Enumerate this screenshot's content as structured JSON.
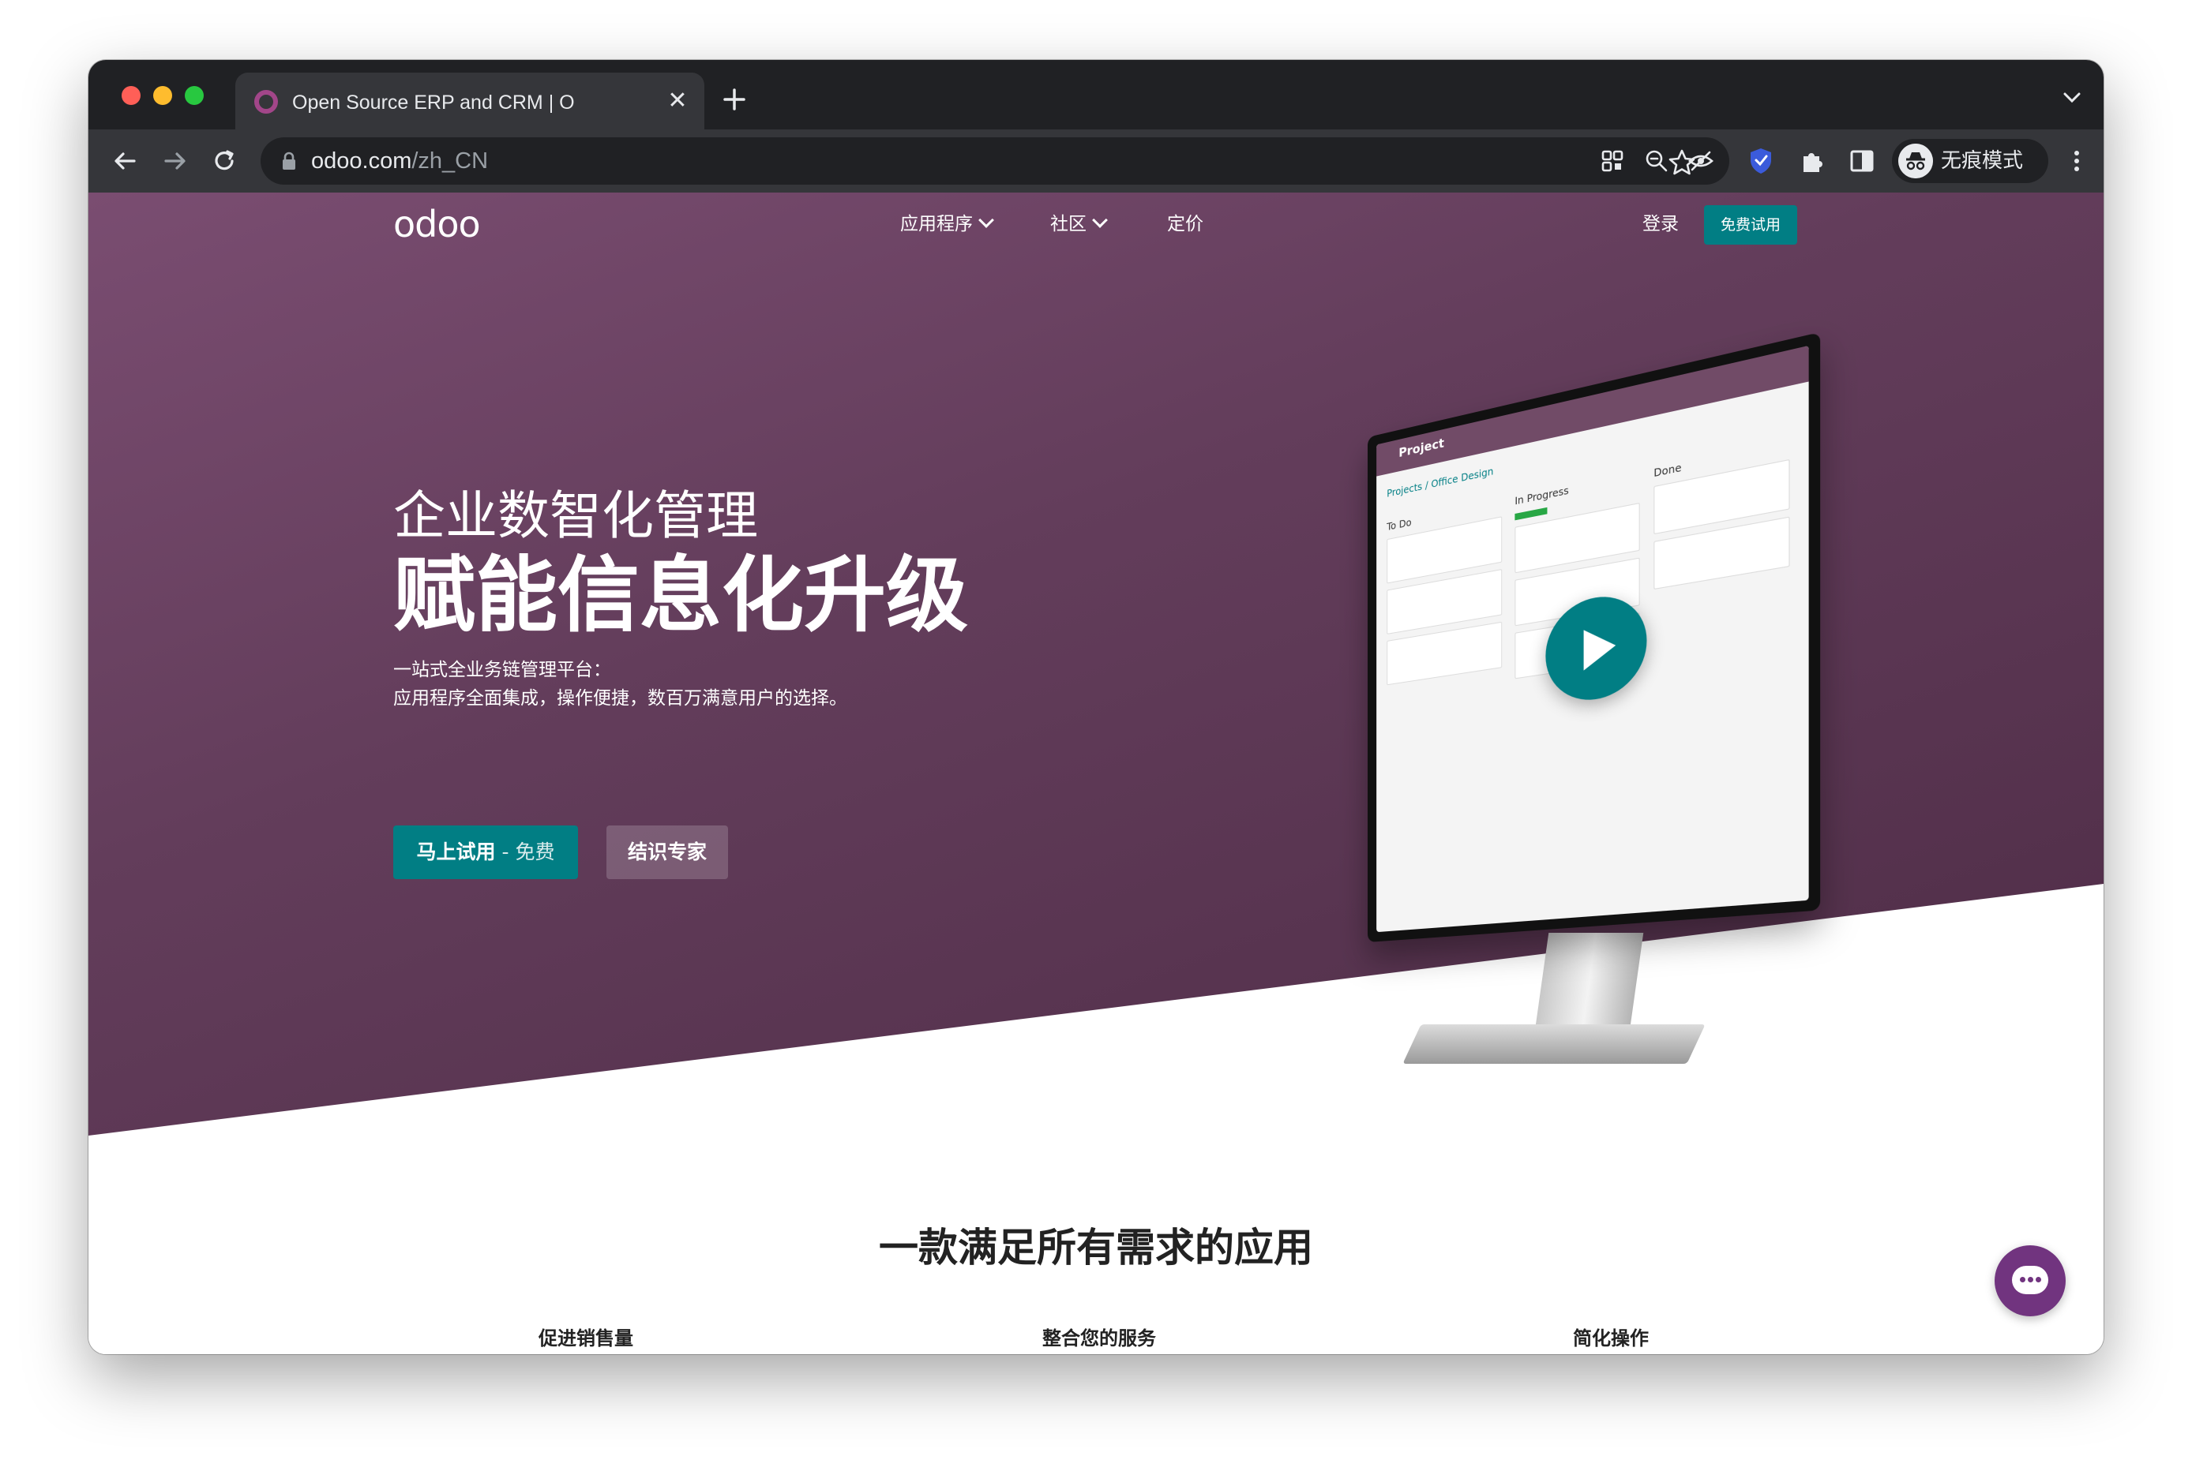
{
  "browser": {
    "tab_title": "Open Source ERP and CRM | O",
    "url_host": "odoo.com",
    "url_path": "/zh_CN",
    "profile_label": "无痕模式"
  },
  "nav": {
    "logo": "odoo",
    "apps": "应用程序",
    "community": "社区",
    "pricing": "定价",
    "login": "登录",
    "free_trial": "免费试用"
  },
  "hero": {
    "line1": "企业数智化管理",
    "line2": "赋能信息化升级",
    "sub1": "一站式全业务链管理平台：",
    "sub2": "应用程序全面集成，操作便捷，数百万满意用户的选择。",
    "cta_primary": "马上试用",
    "cta_primary_suffix": " - 免费",
    "cta_secondary": "结识专家"
  },
  "screen": {
    "app_title": "Project",
    "breadcrumb": "Projects / Office Design",
    "col_todo": "To Do",
    "col_progress": "In Progress",
    "col_done": "Done"
  },
  "section": {
    "title": "一款满足所有需求的应用",
    "groups": [
      "促进销售量",
      "整合您的服务",
      "简化操作"
    ]
  },
  "colors": {
    "brand_purple": "#714b67",
    "teal": "#017e84",
    "chat": "#71347f"
  },
  "icons": [
    "handshake-icon",
    "store-icon",
    "chart-up-icon",
    "puzzle-icon",
    "stopwatch-icon",
    "lifebuoy-icon",
    "box-icon",
    "wrench-icon",
    "window-icon"
  ]
}
